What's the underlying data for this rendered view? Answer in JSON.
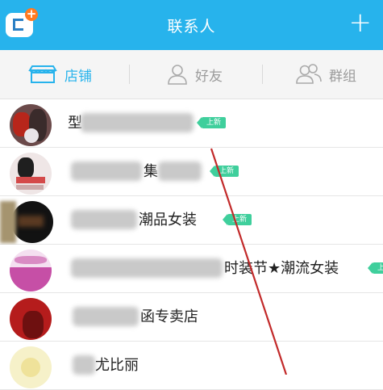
{
  "header": {
    "title": "联系人",
    "add_label": "+"
  },
  "tabs": [
    {
      "label": "店铺",
      "icon": "store-icon",
      "active": true
    },
    {
      "label": "好友",
      "icon": "person-icon",
      "active": false
    },
    {
      "label": "群组",
      "icon": "group-icon",
      "active": false
    }
  ],
  "contacts": [
    {
      "name": "型",
      "tag": "上新"
    },
    {
      "name": "集",
      "tag": "上新"
    },
    {
      "name": "潮品女装",
      "tag": "上新"
    },
    {
      "name": "时装节★潮流女装",
      "tag": "上新"
    },
    {
      "name": "函专卖店",
      "tag": ""
    },
    {
      "name": "尤比丽",
      "tag": ""
    }
  ],
  "colors": {
    "accent": "#27b3ec",
    "tag": "#3fcf9c"
  }
}
